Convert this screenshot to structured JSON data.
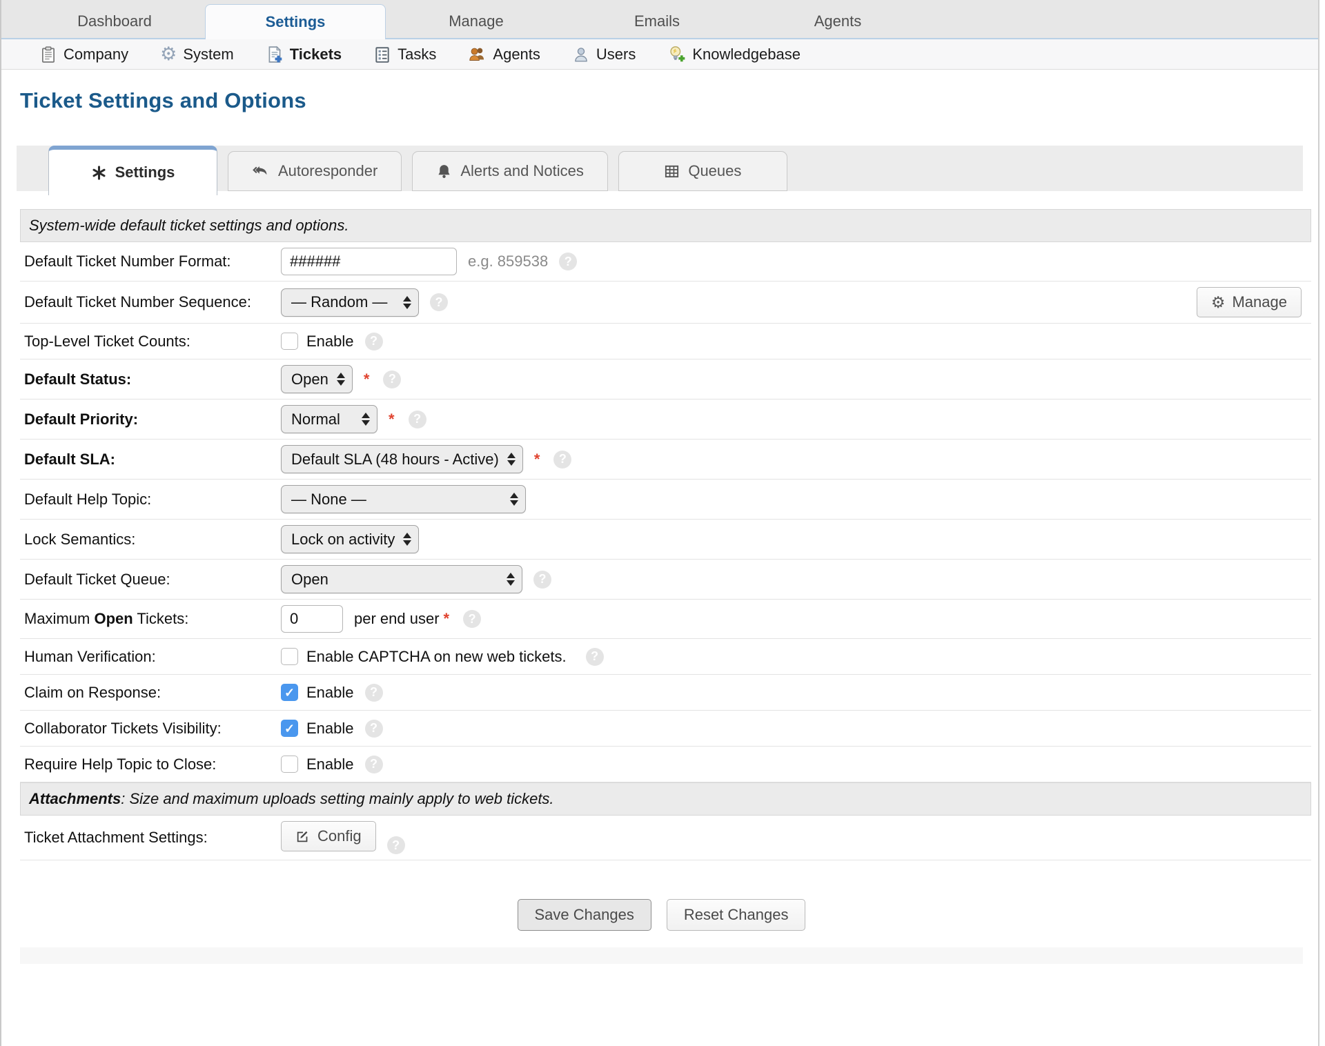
{
  "top_nav": {
    "tabs": [
      "Dashboard",
      "Settings",
      "Manage",
      "Emails",
      "Agents"
    ],
    "active": "Settings"
  },
  "sub_nav": {
    "items": [
      {
        "label": "Company",
        "icon": "clipboard-icon"
      },
      {
        "label": "System",
        "icon": "gear-icon"
      },
      {
        "label": "Tickets",
        "icon": "ticket-new-icon",
        "active": true
      },
      {
        "label": "Tasks",
        "icon": "tasks-icon"
      },
      {
        "label": "Agents",
        "icon": "agents-icon"
      },
      {
        "label": "Users",
        "icon": "users-icon"
      },
      {
        "label": "Knowledgebase",
        "icon": "knowledgebase-icon"
      }
    ]
  },
  "page_title": "Ticket Settings and Options",
  "tabs": [
    {
      "label": "Settings",
      "icon": "asterisk-icon",
      "active": true
    },
    {
      "label": "Autoresponder",
      "icon": "reply-all-icon"
    },
    {
      "label": "Alerts and Notices",
      "icon": "bell-icon"
    },
    {
      "label": "Queues",
      "icon": "table-icon"
    }
  ],
  "sections": {
    "defaults_header": "System-wide default ticket settings and options.",
    "attachments_header_bold": "Attachments",
    "attachments_header_rest": ": Size and maximum uploads setting mainly apply to web tickets."
  },
  "fields": {
    "number_format": {
      "label": "Default Ticket Number Format:",
      "value": "######",
      "hint": "e.g. 859538"
    },
    "number_sequence": {
      "label": "Default Ticket Number Sequence:",
      "value": "— Random —",
      "manage_label": "Manage"
    },
    "top_level_counts": {
      "label": "Top-Level Ticket Counts:",
      "checkbox_label": "Enable",
      "checked": false
    },
    "default_status": {
      "label": "Default Status:",
      "value": "Open",
      "required": "*"
    },
    "default_priority": {
      "label": "Default Priority:",
      "value": "Normal",
      "required": "*"
    },
    "default_sla": {
      "label": "Default SLA:",
      "value": "Default SLA (48 hours - Active)",
      "required": "*"
    },
    "default_help_topic": {
      "label": "Default Help Topic:",
      "value": "— None —"
    },
    "lock_semantics": {
      "label": "Lock Semantics:",
      "value": "Lock on activity"
    },
    "default_ticket_queue": {
      "label": "Default Ticket Queue:",
      "value": "Open"
    },
    "max_open_tickets": {
      "label_prefix": "Maximum ",
      "label_bold": "Open",
      "label_suffix": " Tickets:",
      "value": "0",
      "suffix": "per end user",
      "required": "*"
    },
    "human_verification": {
      "label": "Human Verification:",
      "checkbox_label": "Enable CAPTCHA on new web tickets.",
      "checked": false
    },
    "claim_on_response": {
      "label": "Claim on Response:",
      "checkbox_label": "Enable",
      "checked": true
    },
    "collaborator_visibility": {
      "label": "Collaborator Tickets Visibility:",
      "checkbox_label": "Enable",
      "checked": true
    },
    "require_help_topic": {
      "label": "Require Help Topic to Close:",
      "checkbox_label": "Enable",
      "checked": false
    },
    "attachment_settings": {
      "label": "Ticket Attachment Settings:",
      "button_label": "Config"
    }
  },
  "footer": {
    "save": "Save Changes",
    "reset": "Reset Changes"
  },
  "colors": {
    "accent_blue": "#1b5a8a",
    "checkbox_blue": "#4a97ee",
    "required_red": "#e0432f",
    "tab_accent": "#7fa4d1"
  }
}
